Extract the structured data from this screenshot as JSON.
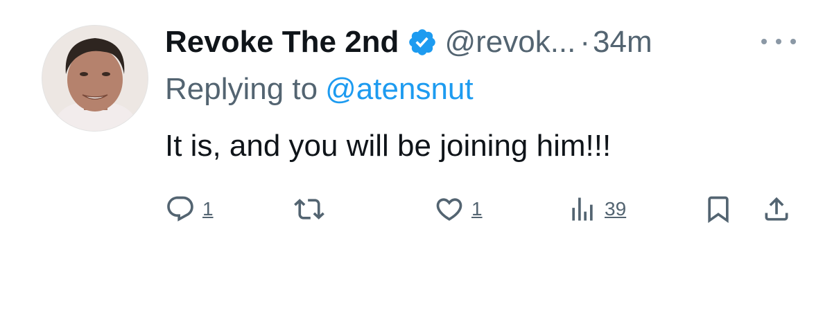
{
  "tweet": {
    "author_name": "Revoke The 2nd",
    "handle": "@revok...",
    "separator": "·",
    "time": "34m",
    "replying_prefix": "Replying to",
    "replying_to": "@atensnut",
    "text": "It is, and you will be joining him!!!"
  },
  "actions": {
    "replies": "1",
    "likes": "1",
    "views": "39"
  },
  "icons": {
    "verified": "verified-badge-icon",
    "more": "more-horizontal-icon",
    "reply": "reply-icon",
    "retweet": "retweet-icon",
    "like": "heart-icon",
    "views": "views-chart-icon",
    "bookmark": "bookmark-icon",
    "share": "share-icon"
  },
  "colors": {
    "text": "#0f1419",
    "secondary": "#536471",
    "accent": "#1d9bf0"
  }
}
